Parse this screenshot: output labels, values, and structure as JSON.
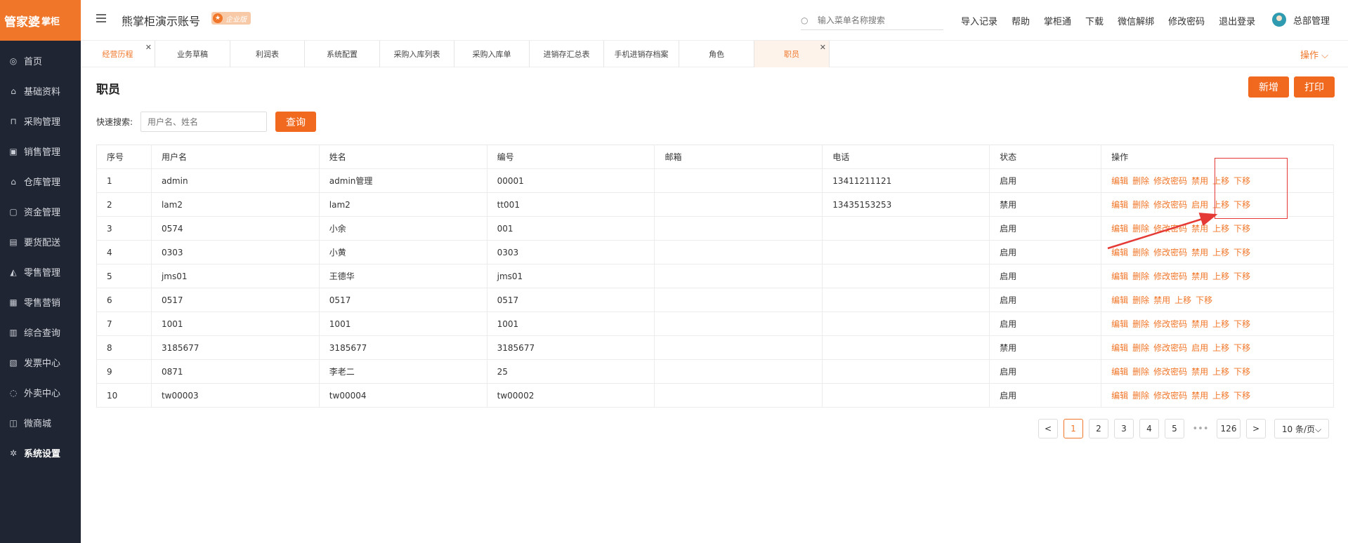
{
  "brand": {
    "logo_text": "管家婆",
    "logo_sub": "掌柜"
  },
  "sidebar": {
    "items": [
      {
        "label": "首页",
        "icon": "globe-icon",
        "glyph": "◎"
      },
      {
        "label": "基础资料",
        "icon": "home-icon",
        "glyph": "⌂"
      },
      {
        "label": "采购管理",
        "icon": "cart-icon",
        "glyph": "⊓"
      },
      {
        "label": "销售管理",
        "icon": "calendar-icon",
        "glyph": "▣"
      },
      {
        "label": "仓库管理",
        "icon": "warehouse-icon",
        "glyph": "⌂"
      },
      {
        "label": "资金管理",
        "icon": "money-icon",
        "glyph": "▢"
      },
      {
        "label": "要货配送",
        "icon": "delivery-icon",
        "glyph": "▤"
      },
      {
        "label": "零售管理",
        "icon": "chart-icon",
        "glyph": "◭"
      },
      {
        "label": "零售营销",
        "icon": "gift-icon",
        "glyph": "▦"
      },
      {
        "label": "综合查询",
        "icon": "bar-chart-icon",
        "glyph": "▥"
      },
      {
        "label": "发票中心",
        "icon": "invoice-icon",
        "glyph": "▧"
      },
      {
        "label": "外卖中心",
        "icon": "alarm-icon",
        "glyph": "◌"
      },
      {
        "label": "微商城",
        "icon": "shop-icon",
        "glyph": "◫"
      },
      {
        "label": "系统设置",
        "icon": "gear-icon",
        "glyph": "✲"
      }
    ]
  },
  "header": {
    "account_name": "熊掌柜演示账号",
    "edition": "企业版",
    "search_placeholder": "输入菜单名称搜索",
    "links": [
      "导入记录",
      "帮助",
      "掌柜通",
      "下载",
      "微信解绑",
      "修改密码",
      "退出登录"
    ],
    "user": "总部管理"
  },
  "tabs": [
    {
      "label": "经营历程"
    },
    {
      "label": "业务草稿"
    },
    {
      "label": "利润表"
    },
    {
      "label": "系统配置"
    },
    {
      "label": "采购入库列表"
    },
    {
      "label": "采购入库单"
    },
    {
      "label": "进销存汇总表"
    },
    {
      "label": "手机进销存档案"
    },
    {
      "label": "角色"
    },
    {
      "label": "职员"
    }
  ],
  "tab_ops": "操作 ⌵",
  "page": {
    "title": "职员",
    "add_label": "新增",
    "print_label": "打印",
    "quick_search_label": "快速搜索:",
    "quick_search_placeholder": "用户名、姓名",
    "query_label": "查询"
  },
  "table": {
    "headers": [
      "序号",
      "用户名",
      "姓名",
      "编号",
      "邮箱",
      "电话",
      "状态",
      "操作"
    ],
    "rows": [
      {
        "no": "1",
        "username": "admin",
        "name": "admin管理",
        "code": "00001",
        "email": "",
        "phone": "13411211121",
        "status": "启用",
        "ops": [
          "编辑",
          "删除",
          "修改密码",
          "禁用",
          "上移",
          "下移"
        ]
      },
      {
        "no": "2",
        "username": "lam2",
        "name": "lam2",
        "code": "tt001",
        "email": "",
        "phone": "13435153253",
        "status": "禁用",
        "ops": [
          "编辑",
          "删除",
          "修改密码",
          "启用",
          "上移",
          "下移"
        ]
      },
      {
        "no": "3",
        "username": "0574",
        "name": "小余",
        "code": "001",
        "email": "",
        "phone": "",
        "status": "启用",
        "ops": [
          "编辑",
          "删除",
          "修改密码",
          "禁用",
          "上移",
          "下移"
        ]
      },
      {
        "no": "4",
        "username": "0303",
        "name": "小黄",
        "code": "0303",
        "email": "",
        "phone": "",
        "status": "启用",
        "ops": [
          "编辑",
          "删除",
          "修改密码",
          "禁用",
          "上移",
          "下移"
        ]
      },
      {
        "no": "5",
        "username": "jms01",
        "name": "王德华",
        "code": "jms01",
        "email": "",
        "phone": "",
        "status": "启用",
        "ops": [
          "编辑",
          "删除",
          "修改密码",
          "禁用",
          "上移",
          "下移"
        ]
      },
      {
        "no": "6",
        "username": "0517",
        "name": "0517",
        "code": "0517",
        "email": "",
        "phone": "",
        "status": "启用",
        "ops": [
          "编辑",
          "删除",
          "禁用",
          "上移",
          "下移"
        ]
      },
      {
        "no": "7",
        "username": "1001",
        "name": "1001",
        "code": "1001",
        "email": "",
        "phone": "",
        "status": "启用",
        "ops": [
          "编辑",
          "删除",
          "修改密码",
          "禁用",
          "上移",
          "下移"
        ]
      },
      {
        "no": "8",
        "username": "3185677",
        "name": "3185677",
        "code": "3185677",
        "email": "",
        "phone": "",
        "status": "禁用",
        "ops": [
          "编辑",
          "删除",
          "修改密码",
          "启用",
          "上移",
          "下移"
        ]
      },
      {
        "no": "9",
        "username": "0871",
        "name": "李老二",
        "code": "25",
        "email": "",
        "phone": "",
        "status": "启用",
        "ops": [
          "编辑",
          "删除",
          "修改密码",
          "禁用",
          "上移",
          "下移"
        ]
      },
      {
        "no": "10",
        "username": "tw00003",
        "name": "tw00004",
        "code": "tw00002",
        "email": "",
        "phone": "",
        "status": "启用",
        "ops": [
          "编辑",
          "删除",
          "修改密码",
          "禁用",
          "上移",
          "下移"
        ]
      }
    ]
  },
  "pagination": {
    "prev": "<",
    "pages": [
      "1",
      "2",
      "3",
      "4",
      "5"
    ],
    "current": "1",
    "dots": "•••",
    "last": "126",
    "next": ">",
    "page_size": "10 条/页⌵"
  },
  "colors": {
    "accent": "#f0772a",
    "sidebar_bg": "#1f2532",
    "annotation": "#e53935"
  }
}
